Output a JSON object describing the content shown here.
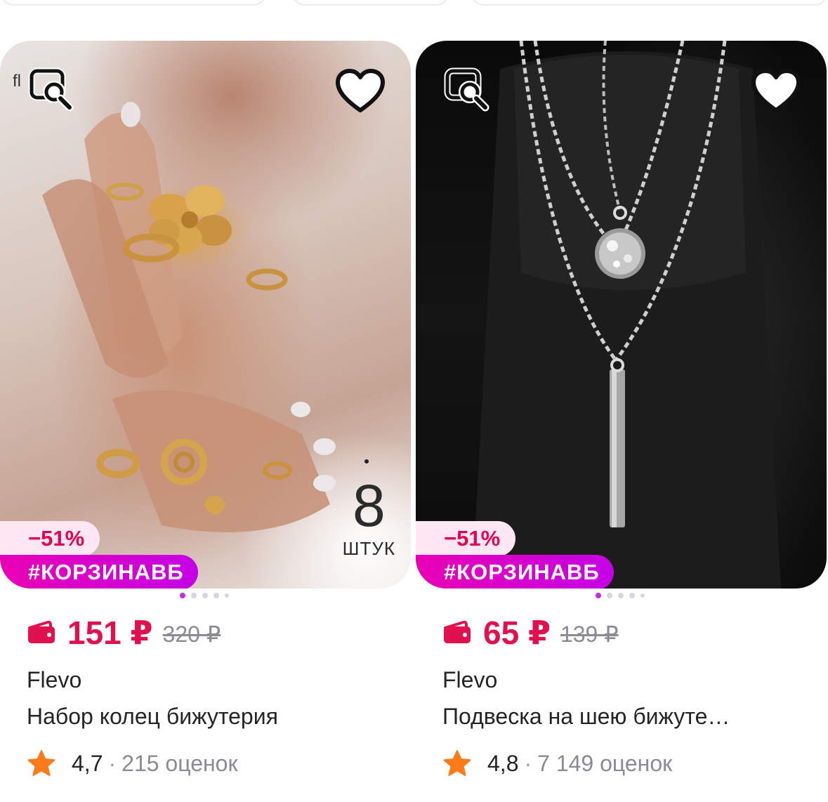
{
  "colors": {
    "accent_price": "#e0114d",
    "promo_gradient_start": "#e800b3",
    "promo_gradient_end": "#c500e6",
    "discount_bg": "#fde7f3",
    "star": "#ff7a1a",
    "active_dot": "#c22de2"
  },
  "products": [
    {
      "image_alt": "rings",
      "discount_badge": "−51%",
      "promo_badge": "#КОРЗИНАВБ",
      "qty_number": "8",
      "qty_unit": "штук",
      "photo_brand_fragment": "fl",
      "price_now": "151 ₽",
      "price_old": "320 ₽",
      "brand": "Flevo",
      "title": "Набор колец бижутерия",
      "rating": "4,7",
      "rating_sep": "·",
      "reviews": "215 оценок",
      "gallery_active_index": 0,
      "gallery_count": 5,
      "icons": {
        "search_similar": "image-search-icon",
        "favorite": "heart-icon",
        "wallet": "wallet-icon",
        "star": "star-icon"
      }
    },
    {
      "image_alt": "necklace",
      "discount_badge": "−51%",
      "promo_badge": "#КОРЗИНАВБ",
      "price_now": "65 ₽",
      "price_old": "139 ₽",
      "brand": "Flevo",
      "title": "Подвеска на шею бижуте…",
      "rating": "4,8",
      "rating_sep": "·",
      "reviews": "7 149 оценок",
      "gallery_active_index": 0,
      "gallery_count": 5,
      "icons": {
        "search_similar": "image-search-icon",
        "favorite": "heart-icon",
        "wallet": "wallet-icon",
        "star": "star-icon"
      }
    }
  ]
}
